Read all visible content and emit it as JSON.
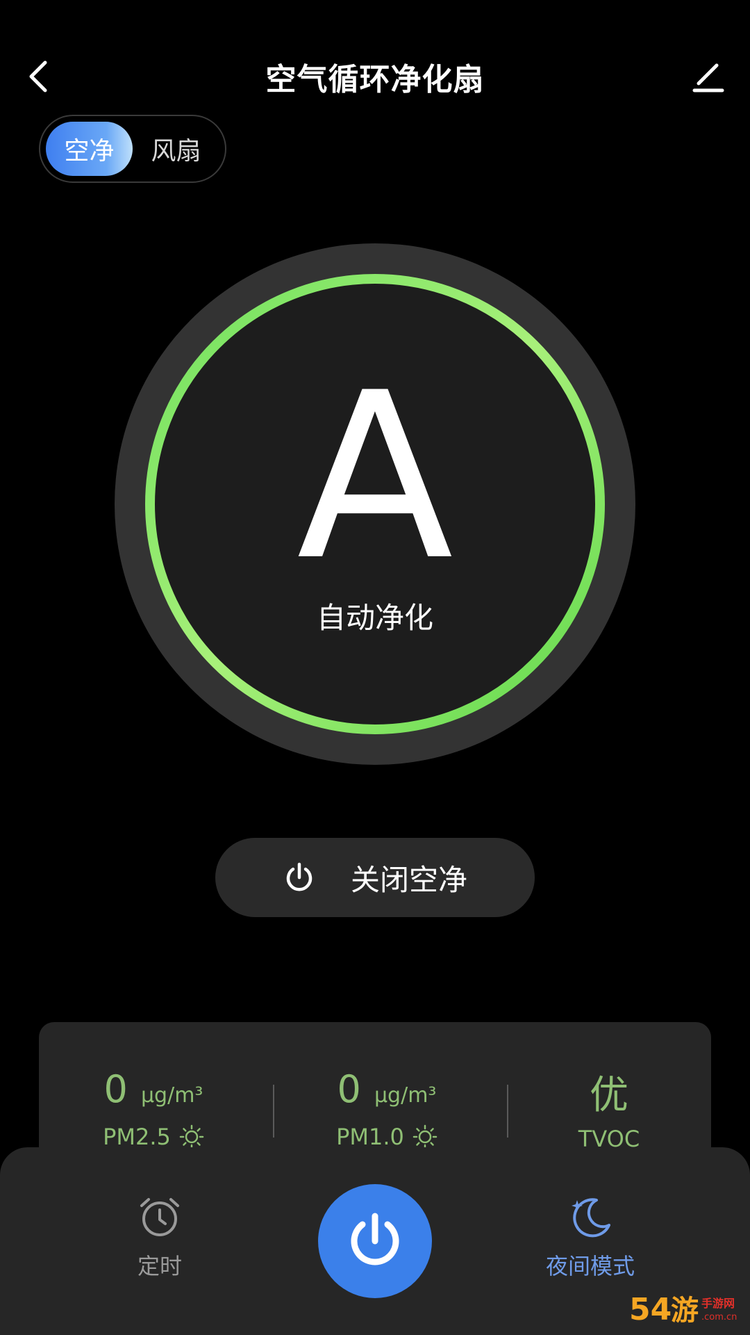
{
  "header": {
    "title": "空气循环净化扇"
  },
  "mode_switch": {
    "tabs": [
      {
        "label": "空净",
        "active": true
      },
      {
        "label": "风扇",
        "active": false
      }
    ]
  },
  "dial": {
    "mode_letter": "A",
    "caption": "自动净化",
    "ring_color": "#7ee86a"
  },
  "close_purify": {
    "label": "关闭空净"
  },
  "sensors": {
    "pm25": {
      "value": "0",
      "unit": "μg/m³",
      "label": "PM2.5"
    },
    "pm10": {
      "value": "0",
      "unit": "μg/m³",
      "label": "PM1.0"
    },
    "tvoc": {
      "value": "优",
      "label": "TVOC"
    },
    "color": "#8fbf74"
  },
  "bottom_bar": {
    "timer_label": "定时",
    "night_label": "夜间模式",
    "timer_color": "#9a9a9a",
    "night_color": "#6f9be8",
    "power_color": "#3b80ea"
  },
  "watermark": {
    "brand_text": "54游手游网",
    "domain_text": ".com.cn"
  }
}
